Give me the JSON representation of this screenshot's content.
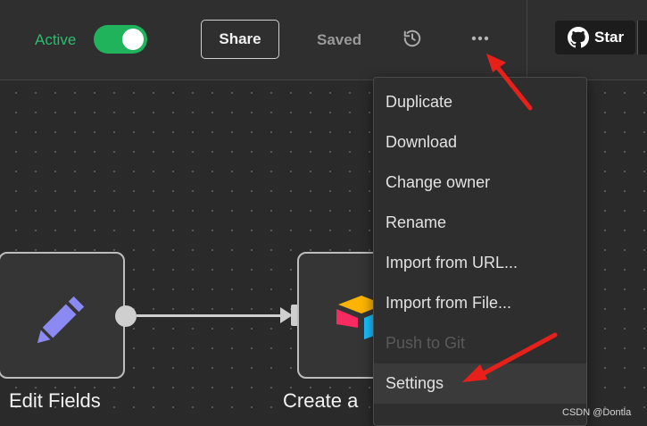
{
  "header": {
    "active_label": "Active",
    "active_toggle_on": true,
    "share_label": "Share",
    "saved_label": "Saved",
    "history_icon": "history-icon",
    "more_icon": "more-horizontal-icon",
    "star_label": "Star",
    "github_icon": "github-icon"
  },
  "canvas": {
    "nodes": [
      {
        "label": "Edit Fields",
        "icon": "pencil-icon"
      },
      {
        "label": "Create a",
        "icon": "airtable-icon"
      }
    ]
  },
  "menu": {
    "items": [
      {
        "label": "Duplicate",
        "disabled": false
      },
      {
        "label": "Download",
        "disabled": false
      },
      {
        "label": "Change owner",
        "disabled": false
      },
      {
        "label": "Rename",
        "disabled": false
      },
      {
        "label": "Import from URL...",
        "disabled": false
      },
      {
        "label": "Import from File...",
        "disabled": false
      },
      {
        "label": "Push to Git",
        "disabled": true
      },
      {
        "label": "Settings",
        "disabled": false
      }
    ]
  },
  "watermark": "CSDN @Dontla",
  "colors": {
    "active_green": "#2bbd6e",
    "toggle_green": "#20b35b",
    "annotation_red": "#e8201a",
    "canvas_bg": "#2a2a2a"
  }
}
